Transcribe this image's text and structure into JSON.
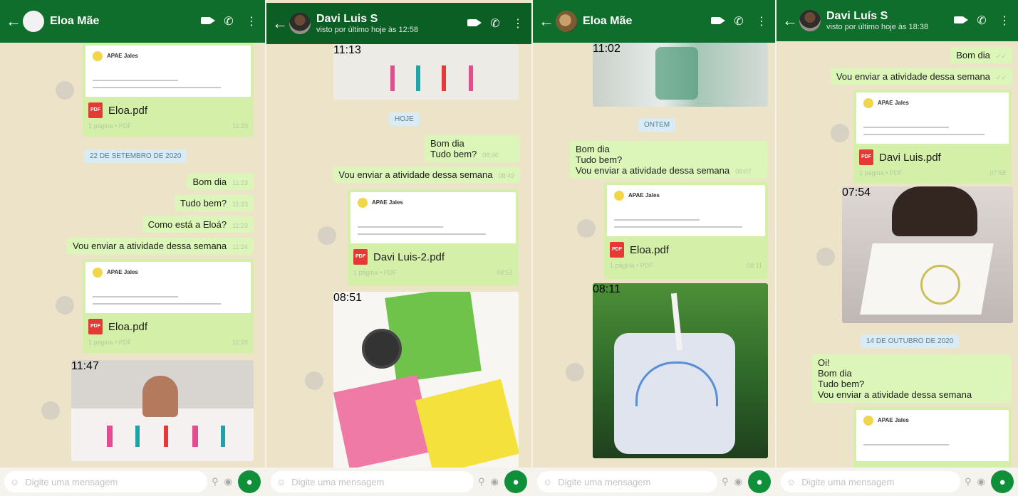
{
  "panels": [
    {
      "name": "Eloa Mãe",
      "status": "",
      "date_chip": "22 DE SETEMBRO DE 2020",
      "doc_title": "APAE Jales",
      "file1": "Eloa.pdf",
      "file1_meta": "1 página • PDF",
      "file1_time": "11:20",
      "msgs": [
        {
          "text": "Bom dia",
          "time": "11:23"
        },
        {
          "text": "Tudo bem?",
          "time": "11:23"
        },
        {
          "text": "Como está a Eloá?",
          "time": "11:23"
        },
        {
          "text": "Vou enviar a atividade dessa semana",
          "time": "11:24"
        }
      ],
      "file2": "Eloa.pdf",
      "file2_meta": "1 página • PDF",
      "file2_time": "11:28",
      "img_time": "11:47",
      "placeholder": "Digite uma mensagem"
    },
    {
      "name": "Davi Luis S",
      "status": "visto por último hoje às 12:58",
      "img1_time": "11:13",
      "date_chip": "HOJE",
      "msg1": "Bom dia",
      "msg2": "Tudo bem?",
      "msg2_time": "08:46",
      "msg3": "Vou enviar a atividade dessa semana",
      "msg3_time": "08:49",
      "doc_title": "APAE Jales",
      "file": "Davi Luis-2.pdf",
      "file_meta": "1 página • PDF",
      "file_time": "08:51",
      "img2_time": "08:51",
      "placeholder": "Digite uma mensagem"
    },
    {
      "name": "Eloa Mãe",
      "img1_time": "11:02",
      "date_chip": "ONTEM",
      "msg1": "Bom dia",
      "msg2": "Tudo bem?",
      "msg3": "Vou enviar a atividade dessa semana",
      "msg3_time": "08:07",
      "doc_title": "APAE Jales",
      "file": "Eloa.pdf",
      "file_meta": "1 página • PDF",
      "file_time": "08:11",
      "img2_time": "08:11",
      "placeholder": "Digite uma mensagem"
    },
    {
      "name": "Davi Luís S",
      "status": "visto por último hoje às 18:38",
      "msg1": "Bom dia",
      "msg2": "Vou enviar a atividade dessa semana",
      "doc_title": "APAE Jales",
      "file": "Davi Luis.pdf",
      "file_meta": "1 página • PDF",
      "file_time": "07:58",
      "img_time": "07:54",
      "date_chip": "14 DE OUTUBRO DE 2020",
      "msg3": "Oi!",
      "msg4": "Bom dia",
      "msg5": "Tudo bem?",
      "msg6": "Vou enviar a atividade dessa semana",
      "doc2_title": "APAE Jales",
      "placeholder": "Digite uma mensagem"
    }
  ]
}
